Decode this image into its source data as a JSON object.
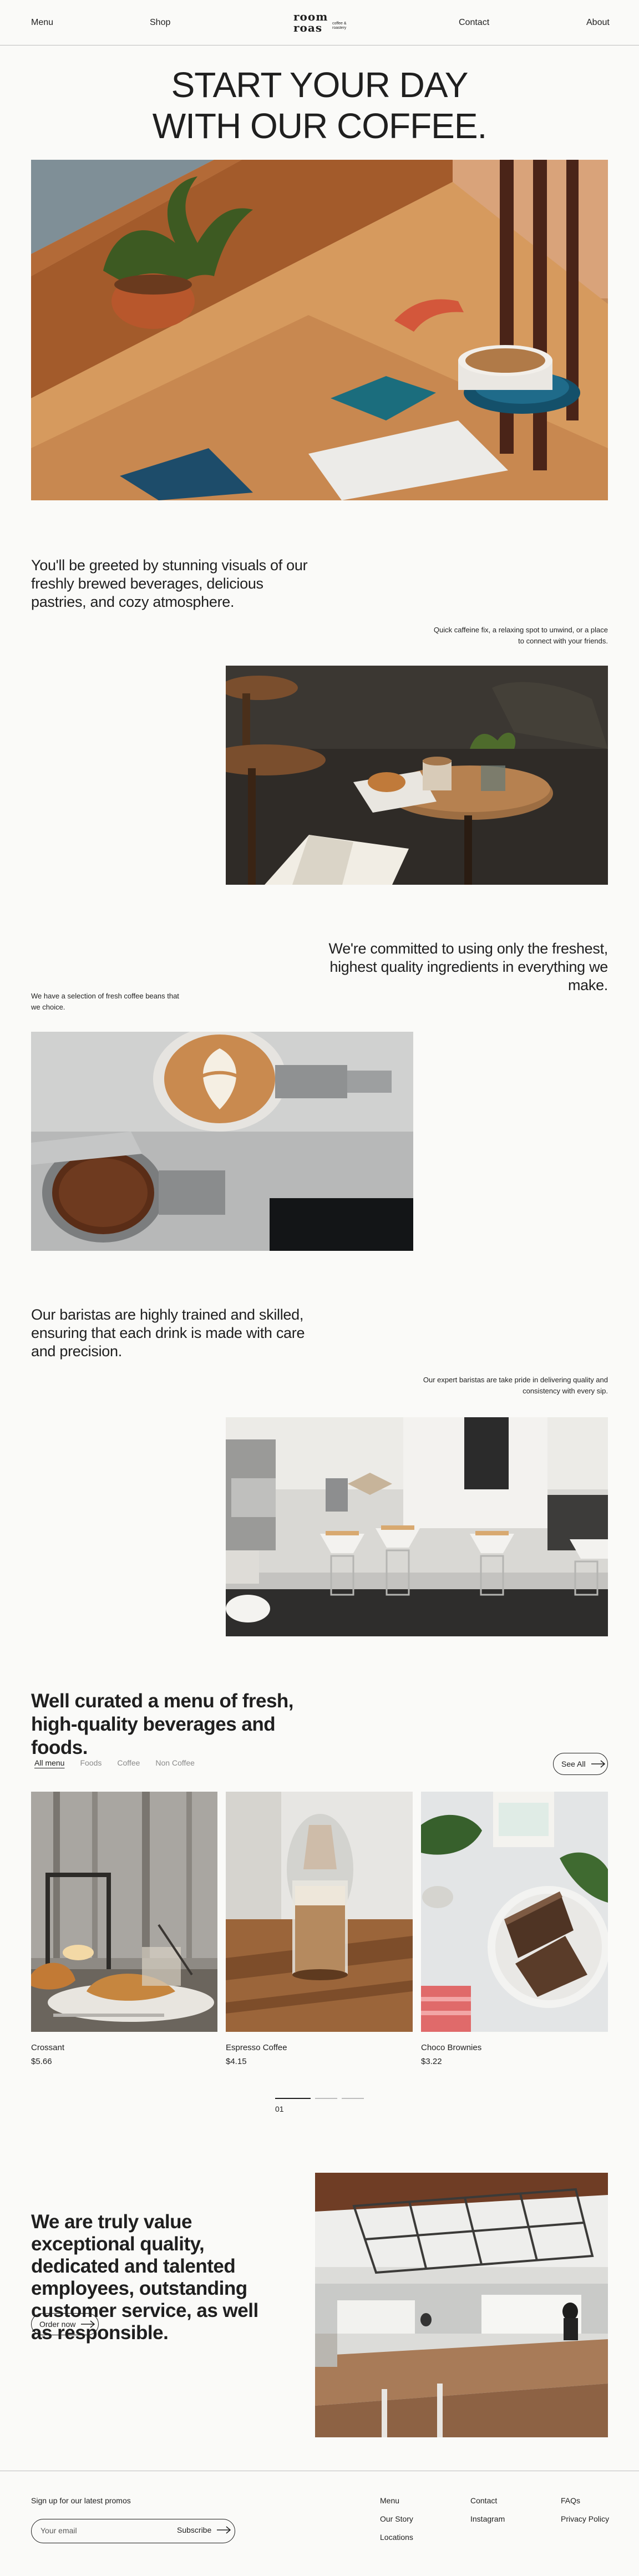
{
  "nav": {
    "menu": "Menu",
    "shop": "Shop",
    "contact": "Contact",
    "about": "About",
    "logo_line1": "room",
    "logo_line2": "roas",
    "logo_sub": "coffee & roastery"
  },
  "hero": {
    "title_line1": "START YOUR DAY",
    "title_line2": "WITH OUR COFFEE."
  },
  "sections": [
    {
      "heading": "You'll be greeted by stunning visuals of our freshly brewed beverages, delicious pastries, and cozy atmosphere.",
      "note": "Quick caffeine fix, a relaxing spot to unwind, or a place to connect with your friends."
    },
    {
      "heading": "We're committed to using only the freshest, highest quality ingredients in everything we make.",
      "note": "We have a selection of fresh coffee beans that we choice."
    },
    {
      "heading": "Our baristas are highly trained and skilled, ensuring that each drink is made with care and precision.",
      "note": "Our expert baristas are take pride in delivering quality and consistency with every sip."
    }
  ],
  "menu": {
    "title": "Well curated a menu of fresh, high-quality beverages and foods.",
    "filters": [
      "All menu",
      "Foods",
      "Coffee",
      "Non Coffee"
    ],
    "active_filter": "All menu",
    "see_all": "See All",
    "items": [
      {
        "name": "Crossant",
        "price": "$5.66"
      },
      {
        "name": "Espresso Coffee",
        "price": "$4.15"
      },
      {
        "name": "Choco Brownies",
        "price": "$3.22"
      }
    ],
    "page": "01"
  },
  "value": {
    "title": "We are truly value exceptional quality, dedicated and talented employees, outstanding customer service, as well as responsible.",
    "order_button": "Order now"
  },
  "footer": {
    "promo": "Sign up for our latest promos",
    "email_placeholder": "Your email",
    "subscribe": "Subscribe",
    "col1": [
      "Menu",
      "Our Story",
      "Locations"
    ],
    "col2": [
      "Contact",
      "Instagram"
    ],
    "col3": [
      "FAQs",
      "Privacy Policy"
    ]
  },
  "colors": {
    "background": "#fafaf8",
    "text": "#1f1f1f",
    "divider": "#bdbdbd"
  }
}
